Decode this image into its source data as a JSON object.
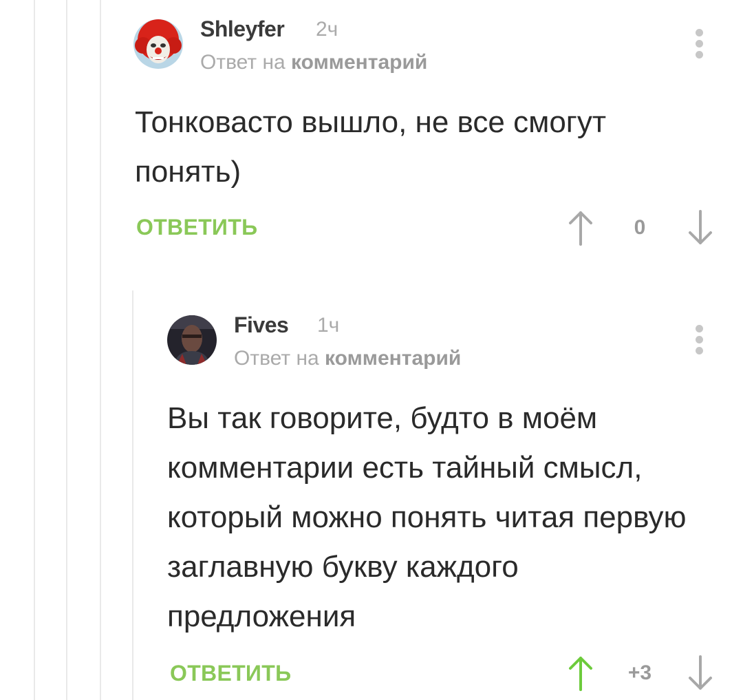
{
  "comments": [
    {
      "author": "Shleyfer",
      "time": "2ч",
      "reply_prefix": "Ответ на",
      "reply_link": "комментарий",
      "text": "Тонковасто вышло, не все смогут понять)",
      "reply_label": "ОТВЕТИТЬ",
      "score": "0",
      "upvoted": false
    },
    {
      "author": "Fives",
      "time": "1ч",
      "reply_prefix": "Ответ на",
      "reply_link": "комментарий",
      "text": "Вы так говорите, будто в моём комментарии есть тайный смысл, который можно понять читая первую заглавную букву каждого предложения",
      "reply_label": "ОТВЕТИТЬ",
      "score": "+3",
      "upvoted": true
    }
  ],
  "colors": {
    "accent_green": "#8ac858",
    "muted_gray": "#aaaaaa",
    "thread_line": "#e9e9e9"
  },
  "icons": [
    "more-vertical-icon",
    "arrow-up-icon",
    "arrow-down-icon"
  ]
}
